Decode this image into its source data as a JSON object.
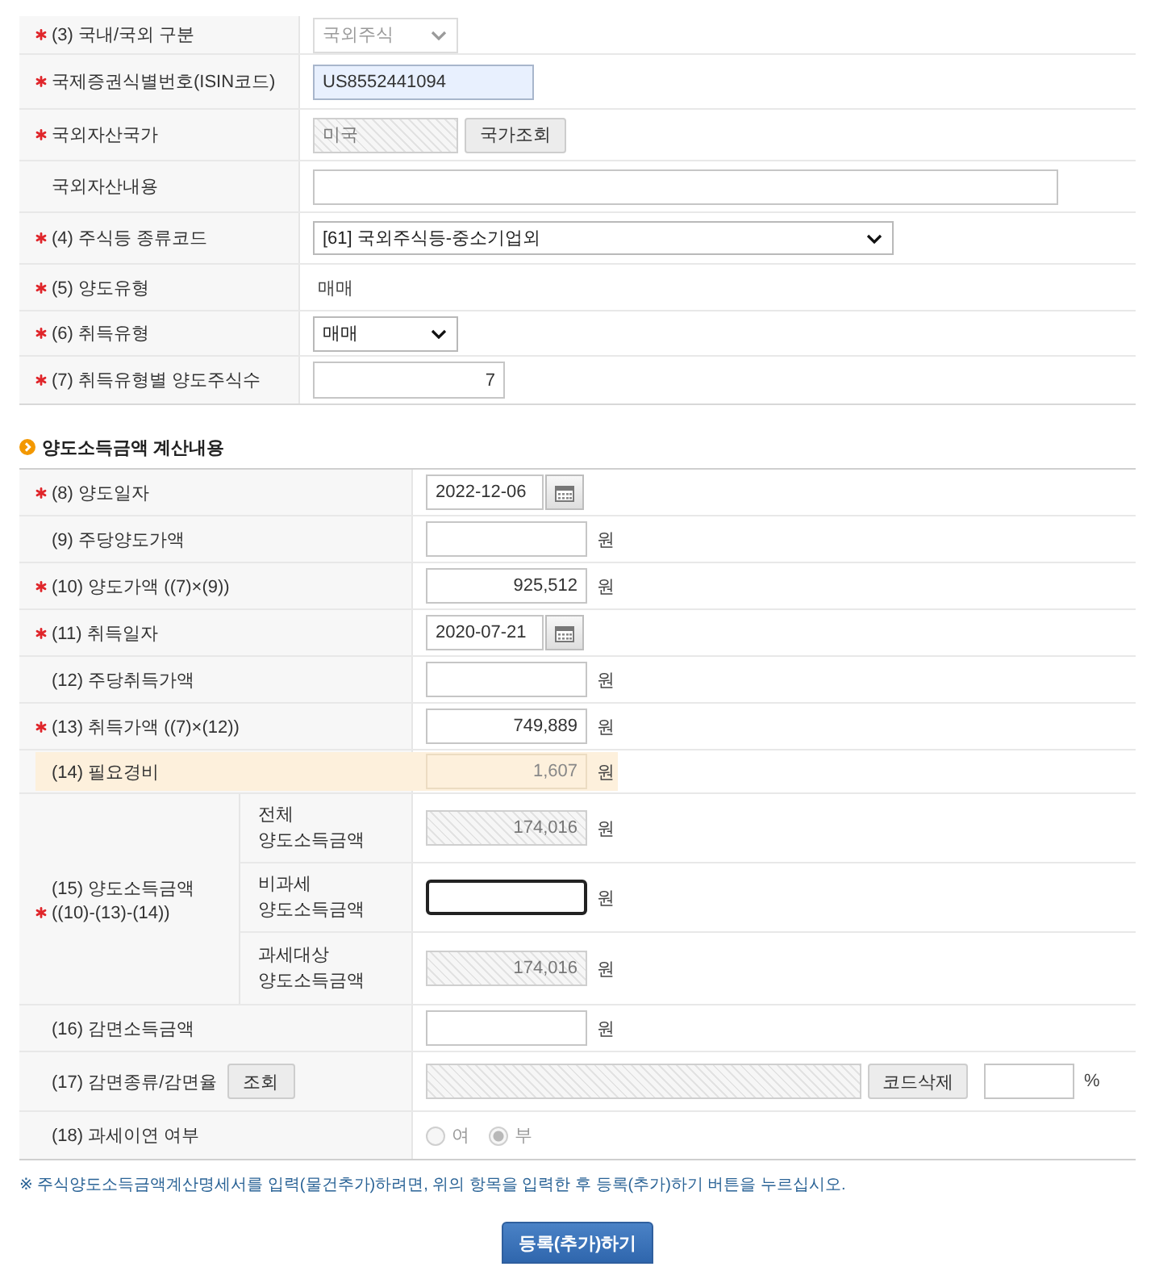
{
  "basic_info": {
    "rows": [
      {
        "kind": "select",
        "required": true,
        "label": "(3) 국내/국외 구분",
        "value": "국외주식",
        "disabled": true
      },
      {
        "kind": "text_input",
        "required": true,
        "label": "국제증권식별번호(ISIN코드)",
        "value": "US8552441094",
        "autofilled": true
      },
      {
        "kind": "lookup",
        "required": true,
        "label": "국외자산국가",
        "value": "미국",
        "button": "국가조회"
      },
      {
        "kind": "text_input",
        "required": false,
        "label": "국외자산내용",
        "autofilled": false
      },
      {
        "kind": "select",
        "required": true,
        "label": "(4) 주식등 종류코드",
        "value": "[61] 국외주식등-중소기업외",
        "disabled": false
      },
      {
        "kind": "text",
        "required": true,
        "label": "(5) 양도유형",
        "value": "매매"
      },
      {
        "kind": "select",
        "required": true,
        "label": "(6) 취득유형",
        "value": "매매",
        "disabled": false
      },
      {
        "kind": "number_input",
        "required": true,
        "label": "(7) 취득유형별 양도주식수",
        "value": "7"
      }
    ]
  },
  "calculation": {
    "heading": "양도소득금액 계산내용",
    "rows": [
      {
        "kind": "date",
        "required": true,
        "label": "(8) 양도일자",
        "value": "2022-12-06"
      },
      {
        "kind": "amount",
        "required": false,
        "label": "(9) 주당양도가액",
        "readonly": false,
        "unit": "원"
      },
      {
        "kind": "amount",
        "required": true,
        "label": "(10) 양도가액 ((7)×(9))",
        "value": "925,512",
        "readonly": false,
        "unit": "원"
      },
      {
        "kind": "date",
        "required": true,
        "label": "(11) 취득일자",
        "value": "2020-07-21"
      },
      {
        "kind": "amount",
        "required": false,
        "label": "(12) 주당취득가액",
        "readonly": false,
        "unit": "원"
      },
      {
        "kind": "amount",
        "required": true,
        "label": "(13) 취득가액 ((7)×(12))",
        "value": "749,889",
        "readonly": false,
        "unit": "원"
      },
      {
        "kind": "amount",
        "required": false,
        "label": "(14) 필요경비",
        "value": "1,607",
        "readonly": false,
        "highlighted": true,
        "unit": "원"
      },
      {
        "kind": "group",
        "required": true,
        "label": "(15) 양도소득금액",
        "formula": "((10)-(13)-(14))",
        "subrows": [
          {
            "label": "전체 양도소득금액",
            "value": "174,016",
            "readonly": true,
            "focused": false,
            "unit": "원"
          },
          {
            "label": "비과세 양도소득금액",
            "readonly": false,
            "focused": true,
            "unit": "원"
          },
          {
            "label": "과세대상 양도소득금액",
            "value": "174,016",
            "readonly": true,
            "focused": false,
            "unit": "원"
          }
        ]
      },
      {
        "kind": "amount",
        "required": false,
        "label": "(16) 감면소득금액",
        "readonly": false,
        "unit": "원"
      },
      {
        "kind": "reduction",
        "required": false,
        "label": "(17) 감면종류/감면율",
        "lookup_button": "조회",
        "code_readonly": true,
        "delete_button": "코드삭제",
        "rate_unit": "%"
      },
      {
        "kind": "radio",
        "required": false,
        "label": "(18) 과세이연 여부",
        "disabled": true,
        "options": [
          {
            "label": "여",
            "selected": false
          },
          {
            "label": "부",
            "selected": true
          }
        ]
      }
    ]
  },
  "note": "※ 주식양도소득금액계산명세서를 입력(물건추가)하려면, 위의 항목을 입력한 후 등록(추가)하기 버튼을 누르십시오.",
  "submit_button": "등록(추가)하기"
}
